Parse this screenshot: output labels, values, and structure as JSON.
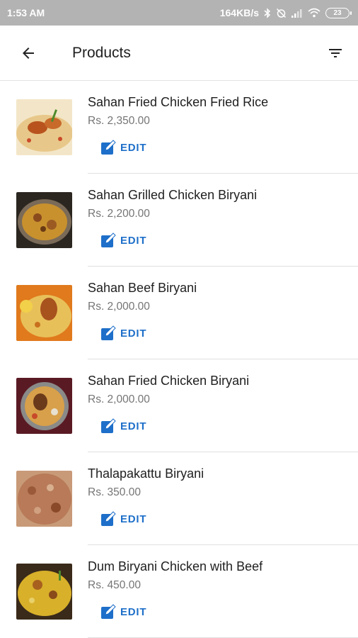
{
  "status_bar": {
    "time": "1:53 AM",
    "network_speed": "164KB/s",
    "battery_level": "23",
    "icons": [
      "bluetooth-icon",
      "alarm-off-icon",
      "signal-icon",
      "wifi-icon",
      "battery-icon"
    ]
  },
  "app_bar": {
    "title": "Products",
    "back_icon": "arrow-back-icon",
    "filter_icon": "filter-list-icon"
  },
  "products": [
    {
      "name": "Sahan Fried Chicken Fried Rice",
      "price": "Rs. 2,350.00",
      "edit_label": "EDIT"
    },
    {
      "name": "Sahan Grilled Chicken Biryani",
      "price": "Rs. 2,200.00",
      "edit_label": "EDIT"
    },
    {
      "name": "Sahan Beef Biryani",
      "price": "Rs. 2,000.00",
      "edit_label": "EDIT"
    },
    {
      "name": "Sahan Fried Chicken Biryani",
      "price": "Rs. 2,000.00",
      "edit_label": "EDIT"
    },
    {
      "name": "Thalapakattu Biryani",
      "price": "Rs. 350.00",
      "edit_label": "EDIT"
    },
    {
      "name": "Dum Biryani Chicken with Beef",
      "price": "Rs. 450.00",
      "edit_label": "EDIT"
    }
  ],
  "colors": {
    "status_bar_bg": "#b3b3b3",
    "accent_blue": "#1e6fc9",
    "divider": "#e0e0e0",
    "price_text": "#757575"
  }
}
